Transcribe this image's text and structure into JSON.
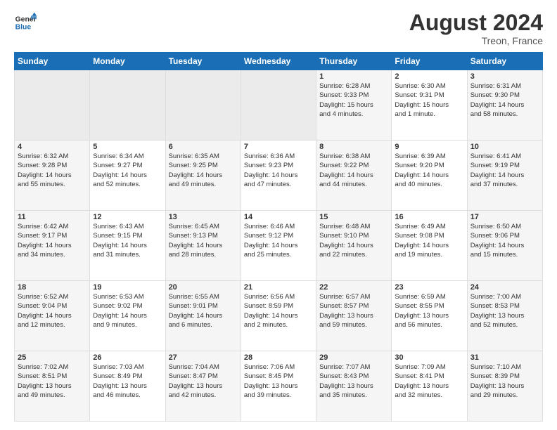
{
  "header": {
    "logo_general": "General",
    "logo_blue": "Blue",
    "month_year": "August 2024",
    "location": "Treon, France"
  },
  "days_of_week": [
    "Sunday",
    "Monday",
    "Tuesday",
    "Wednesday",
    "Thursday",
    "Friday",
    "Saturday"
  ],
  "weeks": [
    [
      {
        "day": "",
        "info": ""
      },
      {
        "day": "",
        "info": ""
      },
      {
        "day": "",
        "info": ""
      },
      {
        "day": "",
        "info": ""
      },
      {
        "day": "1",
        "info": "Sunrise: 6:28 AM\nSunset: 9:33 PM\nDaylight: 15 hours\nand 4 minutes."
      },
      {
        "day": "2",
        "info": "Sunrise: 6:30 AM\nSunset: 9:31 PM\nDaylight: 15 hours\nand 1 minute."
      },
      {
        "day": "3",
        "info": "Sunrise: 6:31 AM\nSunset: 9:30 PM\nDaylight: 14 hours\nand 58 minutes."
      }
    ],
    [
      {
        "day": "4",
        "info": "Sunrise: 6:32 AM\nSunset: 9:28 PM\nDaylight: 14 hours\nand 55 minutes."
      },
      {
        "day": "5",
        "info": "Sunrise: 6:34 AM\nSunset: 9:27 PM\nDaylight: 14 hours\nand 52 minutes."
      },
      {
        "day": "6",
        "info": "Sunrise: 6:35 AM\nSunset: 9:25 PM\nDaylight: 14 hours\nand 49 minutes."
      },
      {
        "day": "7",
        "info": "Sunrise: 6:36 AM\nSunset: 9:23 PM\nDaylight: 14 hours\nand 47 minutes."
      },
      {
        "day": "8",
        "info": "Sunrise: 6:38 AM\nSunset: 9:22 PM\nDaylight: 14 hours\nand 44 minutes."
      },
      {
        "day": "9",
        "info": "Sunrise: 6:39 AM\nSunset: 9:20 PM\nDaylight: 14 hours\nand 40 minutes."
      },
      {
        "day": "10",
        "info": "Sunrise: 6:41 AM\nSunset: 9:19 PM\nDaylight: 14 hours\nand 37 minutes."
      }
    ],
    [
      {
        "day": "11",
        "info": "Sunrise: 6:42 AM\nSunset: 9:17 PM\nDaylight: 14 hours\nand 34 minutes."
      },
      {
        "day": "12",
        "info": "Sunrise: 6:43 AM\nSunset: 9:15 PM\nDaylight: 14 hours\nand 31 minutes."
      },
      {
        "day": "13",
        "info": "Sunrise: 6:45 AM\nSunset: 9:13 PM\nDaylight: 14 hours\nand 28 minutes."
      },
      {
        "day": "14",
        "info": "Sunrise: 6:46 AM\nSunset: 9:12 PM\nDaylight: 14 hours\nand 25 minutes."
      },
      {
        "day": "15",
        "info": "Sunrise: 6:48 AM\nSunset: 9:10 PM\nDaylight: 14 hours\nand 22 minutes."
      },
      {
        "day": "16",
        "info": "Sunrise: 6:49 AM\nSunset: 9:08 PM\nDaylight: 14 hours\nand 19 minutes."
      },
      {
        "day": "17",
        "info": "Sunrise: 6:50 AM\nSunset: 9:06 PM\nDaylight: 14 hours\nand 15 minutes."
      }
    ],
    [
      {
        "day": "18",
        "info": "Sunrise: 6:52 AM\nSunset: 9:04 PM\nDaylight: 14 hours\nand 12 minutes."
      },
      {
        "day": "19",
        "info": "Sunrise: 6:53 AM\nSunset: 9:02 PM\nDaylight: 14 hours\nand 9 minutes."
      },
      {
        "day": "20",
        "info": "Sunrise: 6:55 AM\nSunset: 9:01 PM\nDaylight: 14 hours\nand 6 minutes."
      },
      {
        "day": "21",
        "info": "Sunrise: 6:56 AM\nSunset: 8:59 PM\nDaylight: 14 hours\nand 2 minutes."
      },
      {
        "day": "22",
        "info": "Sunrise: 6:57 AM\nSunset: 8:57 PM\nDaylight: 13 hours\nand 59 minutes."
      },
      {
        "day": "23",
        "info": "Sunrise: 6:59 AM\nSunset: 8:55 PM\nDaylight: 13 hours\nand 56 minutes."
      },
      {
        "day": "24",
        "info": "Sunrise: 7:00 AM\nSunset: 8:53 PM\nDaylight: 13 hours\nand 52 minutes."
      }
    ],
    [
      {
        "day": "25",
        "info": "Sunrise: 7:02 AM\nSunset: 8:51 PM\nDaylight: 13 hours\nand 49 minutes."
      },
      {
        "day": "26",
        "info": "Sunrise: 7:03 AM\nSunset: 8:49 PM\nDaylight: 13 hours\nand 46 minutes."
      },
      {
        "day": "27",
        "info": "Sunrise: 7:04 AM\nSunset: 8:47 PM\nDaylight: 13 hours\nand 42 minutes."
      },
      {
        "day": "28",
        "info": "Sunrise: 7:06 AM\nSunset: 8:45 PM\nDaylight: 13 hours\nand 39 minutes."
      },
      {
        "day": "29",
        "info": "Sunrise: 7:07 AM\nSunset: 8:43 PM\nDaylight: 13 hours\nand 35 minutes."
      },
      {
        "day": "30",
        "info": "Sunrise: 7:09 AM\nSunset: 8:41 PM\nDaylight: 13 hours\nand 32 minutes."
      },
      {
        "day": "31",
        "info": "Sunrise: 7:10 AM\nSunset: 8:39 PM\nDaylight: 13 hours\nand 29 minutes."
      }
    ]
  ]
}
